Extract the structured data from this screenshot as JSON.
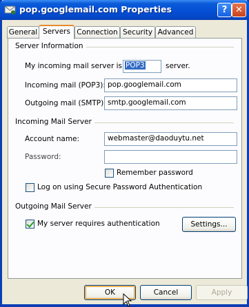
{
  "window": {
    "title": "pop.googlemail.com Properties",
    "help_glyph": "?",
    "close_glyph": "✕"
  },
  "tabs": [
    {
      "label": "General",
      "active": false
    },
    {
      "label": "Servers",
      "active": true
    },
    {
      "label": "Connection",
      "active": false
    },
    {
      "label": "Security",
      "active": false
    },
    {
      "label": "Advanced",
      "active": false
    }
  ],
  "server_info": {
    "group_title": "Server Information",
    "incoming_type_prefix": "My incoming mail server is a",
    "incoming_type_value": "POP3",
    "incoming_type_suffix": "server.",
    "incoming_label": "Incoming mail (POP3):",
    "incoming_value": "pop.googlemail.com",
    "outgoing_label": "Outgoing mail (SMTP):",
    "outgoing_value": "smtp.googlemail.com"
  },
  "incoming_server": {
    "group_title": "Incoming Mail Server",
    "account_label": "Account name:",
    "account_value": "webmaster@daoduytu.net",
    "password_label": "Password:",
    "password_value": "",
    "remember_label": "Remember password",
    "remember_checked": false,
    "spa_label": "Log on using Secure Password Authentication",
    "spa_checked": false
  },
  "outgoing_server": {
    "group_title": "Outgoing Mail Server",
    "auth_label": "My server requires authentication",
    "auth_checked": true,
    "settings_label": "Settings..."
  },
  "footer": {
    "ok_label": "OK",
    "cancel_label": "Cancel",
    "apply_label": "Apply"
  },
  "colors": {
    "titlebar": "#0550d6",
    "dialog": "#ece9d8",
    "active_tab_accent": "#e68b2c",
    "check": "#21a121"
  }
}
